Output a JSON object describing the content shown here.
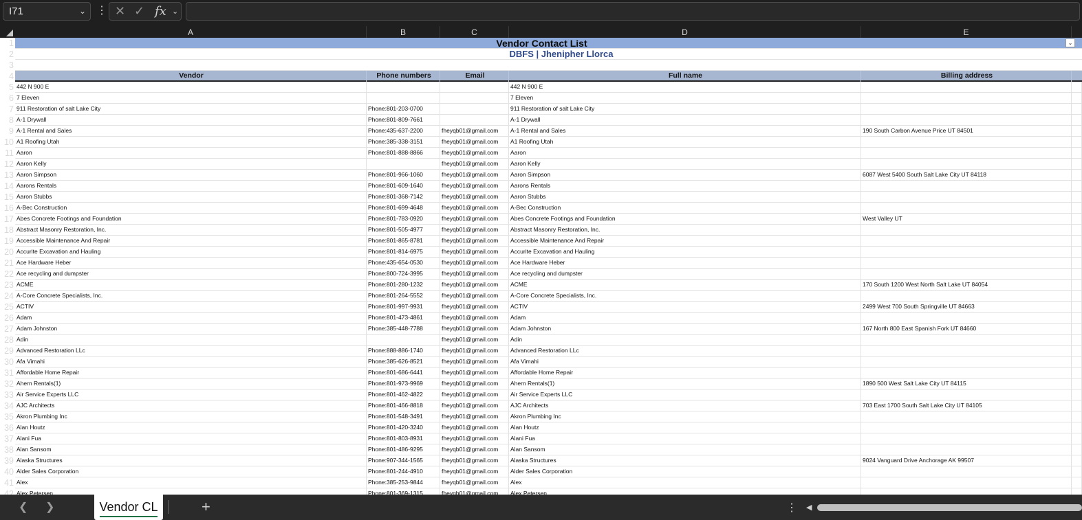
{
  "formula_bar": {
    "name_box": "I71",
    "formula": ""
  },
  "columns": [
    "A",
    "B",
    "C",
    "D",
    "E"
  ],
  "title": "Vendor Contact List",
  "subtitle": "DBFS | Jhenipher Llorca",
  "headers": {
    "vendor": "Vendor",
    "phone": "Phone numbers",
    "email": "Email",
    "fullname": "Full name",
    "billing": "Billing address"
  },
  "row_numbers": [
    "1",
    "2",
    "3",
    "4",
    "5",
    "6",
    "7",
    "8",
    "9",
    "10",
    "11",
    "12",
    "13",
    "14",
    "15",
    "16",
    "17",
    "18",
    "19",
    "20",
    "21",
    "22",
    "23",
    "24",
    "25",
    "26",
    "27",
    "28",
    "29",
    "30",
    "31",
    "32",
    "33",
    "34",
    "35",
    "36",
    "37",
    "38",
    "39",
    "40",
    "41",
    "42"
  ],
  "rows": [
    {
      "vendor": "442 N 900 E",
      "phone": "",
      "email": "",
      "fullname": "442 N 900 E",
      "billing": ""
    },
    {
      "vendor": "7 Eleven",
      "phone": "",
      "email": "",
      "fullname": "7 Eleven",
      "billing": ""
    },
    {
      "vendor": "911 Restoration of salt Lake City",
      "phone": "Phone:801-203-0700",
      "email": "",
      "fullname": "911 Restoration of salt Lake City",
      "billing": ""
    },
    {
      "vendor": "A-1 Drywall",
      "phone": "Phone:801-809-7661",
      "email": "",
      "fullname": "A-1 Drywall",
      "billing": ""
    },
    {
      "vendor": "A-1 Rental and Sales",
      "phone": "Phone:435-637-2200",
      "email": "fheyqb01@gmail.com",
      "fullname": "A-1 Rental and Sales",
      "billing": "190 South Carbon Avenue Price UT 84501"
    },
    {
      "vendor": "A1 Roofing Utah",
      "phone": "Phone:385-338-3151",
      "email": "fheyqb01@gmail.com",
      "fullname": "A1 Roofing Utah",
      "billing": ""
    },
    {
      "vendor": "Aaron",
      "phone": "Phone:801-888-8866",
      "email": "fheyqb01@gmail.com",
      "fullname": "Aaron",
      "billing": ""
    },
    {
      "vendor": "Aaron Kelly",
      "phone": "",
      "email": "fheyqb01@gmail.com",
      "fullname": "Aaron Kelly",
      "billing": ""
    },
    {
      "vendor": "Aaron Simpson",
      "phone": "Phone:801-966-1060",
      "email": "fheyqb01@gmail.com",
      "fullname": "Aaron Simpson",
      "billing": "6087 West 5400 South Salt Lake City UT 84118"
    },
    {
      "vendor": "Aarons Rentals",
      "phone": "Phone:801-609-1640",
      "email": "fheyqb01@gmail.com",
      "fullname": "Aarons Rentals",
      "billing": ""
    },
    {
      "vendor": "Aaron Stubbs",
      "phone": "Phone:801-368-7142",
      "email": "fheyqb01@gmail.com",
      "fullname": "Aaron Stubbs",
      "billing": ""
    },
    {
      "vendor": "A-Bec Construction",
      "phone": "Phone:801-699-4648",
      "email": "fheyqb01@gmail.com",
      "fullname": "A-Bec Construction",
      "billing": ""
    },
    {
      "vendor": "Abes Concrete Footings and Foundation",
      "phone": "Phone:801-783-0920",
      "email": "fheyqb01@gmail.com",
      "fullname": "Abes Concrete Footings and Foundation",
      "billing": "West Valley UT"
    },
    {
      "vendor": "Abstract Masonry Restoration, Inc.",
      "phone": "Phone:801-505-4977",
      "email": "fheyqb01@gmail.com",
      "fullname": "Abstract Masonry Restoration, Inc.",
      "billing": ""
    },
    {
      "vendor": "Accessible Maintenance And Repair",
      "phone": "Phone:801-865-8781",
      "email": "fheyqb01@gmail.com",
      "fullname": "Accessible Maintenance And Repair",
      "billing": ""
    },
    {
      "vendor": "Accurite Excavation and Hauling",
      "phone": "Phone:801-814-6975",
      "email": "fheyqb01@gmail.com",
      "fullname": "Accurite Excavation and Hauling",
      "billing": ""
    },
    {
      "vendor": "Ace Hardware Heber",
      "phone": "Phone:435-654-0530",
      "email": "fheyqb01@gmail.com",
      "fullname": "Ace Hardware Heber",
      "billing": ""
    },
    {
      "vendor": "Ace recycling and dumpster",
      "phone": "Phone:800-724-3995",
      "email": "fheyqb01@gmail.com",
      "fullname": "Ace recycling and dumpster",
      "billing": ""
    },
    {
      "vendor": "ACME",
      "phone": "Phone:801-280-1232",
      "email": "fheyqb01@gmail.com",
      "fullname": "ACME",
      "billing": "170 South 1200 West North Salt Lake UT 84054"
    },
    {
      "vendor": "A-Core Concrete Specialists, Inc.",
      "phone": "Phone:801-264-5552",
      "email": "fheyqb01@gmail.com",
      "fullname": "A-Core Concrete Specialists, Inc.",
      "billing": ""
    },
    {
      "vendor": "ACTIV",
      "phone": "Phone:801-997-9931",
      "email": "fheyqb01@gmail.com",
      "fullname": "ACTIV",
      "billing": "2499 West 700 South Springville UT 84663"
    },
    {
      "vendor": "Adam",
      "phone": "Phone:801-473-4861",
      "email": "fheyqb01@gmail.com",
      "fullname": "Adam",
      "billing": ""
    },
    {
      "vendor": "Adam Johnston",
      "phone": "Phone:385-448-7788",
      "email": "fheyqb01@gmail.com",
      "fullname": "Adam Johnston",
      "billing": "167 North 800 East Spanish Fork UT 84660"
    },
    {
      "vendor": "Adin",
      "phone": "",
      "email": "fheyqb01@gmail.com",
      "fullname": "Adin",
      "billing": ""
    },
    {
      "vendor": "Advanced Restoration LLc",
      "phone": "Phone:888-886-1740",
      "email": "fheyqb01@gmail.com",
      "fullname": "Advanced Restoration LLc",
      "billing": ""
    },
    {
      "vendor": "Afa Vimahi",
      "phone": "Phone:385-626-8521",
      "email": "fheyqb01@gmail.com",
      "fullname": "Afa Vimahi",
      "billing": ""
    },
    {
      "vendor": "Affordable Home Repair",
      "phone": "Phone:801-686-6441",
      "email": "fheyqb01@gmail.com",
      "fullname": "Affordable Home Repair",
      "billing": ""
    },
    {
      "vendor": "Ahern Rentals(1)",
      "phone": "Phone:801-973-9969",
      "email": "fheyqb01@gmail.com",
      "fullname": "Ahern Rentals(1)",
      "billing": "1890 500 West Salt Lake City UT 84115"
    },
    {
      "vendor": "Air Service Experts LLC",
      "phone": "Phone:801-462-4822",
      "email": "fheyqb01@gmail.com",
      "fullname": "Air Service Experts LLC",
      "billing": ""
    },
    {
      "vendor": "AJC Architects",
      "phone": "Phone:801-466-8818",
      "email": "fheyqb01@gmail.com",
      "fullname": "AJC Architects",
      "billing": "703 East 1700 South Salt Lake City UT 84105"
    },
    {
      "vendor": "Akron Plumbing Inc",
      "phone": "Phone:801-548-3491",
      "email": "fheyqb01@gmail.com",
      "fullname": "Akron Plumbing Inc",
      "billing": ""
    },
    {
      "vendor": "Alan Houtz",
      "phone": "Phone:801-420-3240",
      "email": "fheyqb01@gmail.com",
      "fullname": "Alan Houtz",
      "billing": ""
    },
    {
      "vendor": "Alani Fua",
      "phone": "Phone:801-803-8931",
      "email": "fheyqb01@gmail.com",
      "fullname": "Alani Fua",
      "billing": ""
    },
    {
      "vendor": "Alan Sansom",
      "phone": "Phone:801-486-9295",
      "email": "fheyqb01@gmail.com",
      "fullname": "Alan Sansom",
      "billing": ""
    },
    {
      "vendor": "Alaska Structures",
      "phone": "Phone:907-344-1565",
      "email": "fheyqb01@gmail.com",
      "fullname": "Alaska Structures",
      "billing": "9024 Vanguard Drive Anchorage AK 99507"
    },
    {
      "vendor": "Alder Sales Corporation",
      "phone": "Phone:801-244-4910",
      "email": "fheyqb01@gmail.com",
      "fullname": "Alder Sales Corporation",
      "billing": ""
    },
    {
      "vendor": "Alex",
      "phone": "Phone:385-253-9844",
      "email": "fheyqb01@gmail.com",
      "fullname": "Alex",
      "billing": ""
    },
    {
      "vendor": "Alex Petersen",
      "phone": "Phone:801-369-1315",
      "email": "fheyqb01@gmail.com",
      "fullname": "Alex Petersen",
      "billing": ""
    }
  ],
  "sheet_tab": "Vendor CL",
  "colors": {
    "title_bg": "#8eaadb",
    "header_bg": "#a8b7d1",
    "subtitle_text": "#2f4a8a",
    "tab_underline": "#1e7145"
  }
}
